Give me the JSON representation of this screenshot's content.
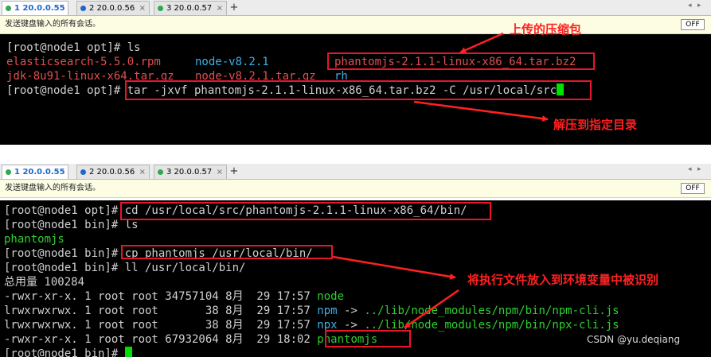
{
  "window1": {
    "tabs": [
      {
        "label": "1 20.0.0.55",
        "active": true,
        "dot_color": "#2fa84f"
      },
      {
        "label": "2 20.0.0.56",
        "active": false,
        "dot_color": "#1f66c9"
      },
      {
        "label": "3 20.0.0.57",
        "active": false,
        "dot_color": "#2fa84f"
      }
    ],
    "add_tab": "+",
    "send_bar_text": "发送键盘输入的所有会话。",
    "off_button": "OFF",
    "terminal": {
      "prompt1": "[root@node1 opt]# ",
      "cmd1": "ls",
      "file_es": "elasticsearch-5.5.0.rpm",
      "file_node": "node-v8.2.1",
      "file_phantom": "phantomjs-2.1.1-linux-x86_64.tar.bz2",
      "file_jdk": "jdk-8u91-linux-x64.tar.gz",
      "file_nodetar": "node-v8.2.1.tar.gz",
      "file_rh": "rh",
      "prompt2": "[root@node1 opt]# ",
      "cmd2": "tar -jxvf phantomjs-2.1.1-linux-x86_64.tar.bz2 -C /usr/local/src"
    }
  },
  "window2": {
    "tabs": [
      {
        "label": "1 20.0.0.55",
        "active": true,
        "dot_color": "#2fa84f"
      },
      {
        "label": "2 20.0.0.56",
        "active": false,
        "dot_color": "#1f66c9"
      },
      {
        "label": "3 20.0.0.57",
        "active": false,
        "dot_color": "#2fa84f"
      }
    ],
    "add_tab": "+",
    "send_bar_text": "发送键盘输入的所有会话。",
    "off_button": "OFF",
    "terminal": {
      "l1_prompt": "[root@node1 opt]# ",
      "l1_cmd": "cd /usr/local/src/phantomjs-2.1.1-linux-x86_64/bin/",
      "l2_prompt": "[root@node1 bin]# ",
      "l2_cmd": "ls",
      "l3": "phantomjs",
      "l4_prompt": "[root@node1 bin]# ",
      "l4_cmd": "cp phantomjs /usr/local/bin/",
      "l5_prompt": "[root@node1 bin]# ",
      "l5_cmd": "ll /usr/local/bin/",
      "l6": "总用量 100284",
      "r1_meta": "-rwxr-xr-x. 1 root root 34757104 8月  29 17:57 ",
      "r1_name": "node",
      "r2_meta": "lrwxrwxrwx. 1 root root       38 8月  29 17:57 ",
      "r2_name": "npm",
      "r2_arrow": " -> ",
      "r2_target": "../lib/node_modules/npm/bin/npm-cli.js",
      "r3_meta": "lrwxrwxrwx. 1 root root       38 8月  29 17:57 ",
      "r3_name": "npx",
      "r3_arrow": " -> ",
      "r3_target": "../lib/node_modules/npm/bin/npx-cli.js",
      "r4_meta": "-rwxr-xr-x. 1 root root 67932064 8月  29 18:02 ",
      "r4_name": "phantomjs",
      "l11_prompt": "[root@node1 bin]# "
    }
  },
  "annotations": {
    "uploaded_package": "上传的压缩包",
    "extract_to_dir": "解压到指定目录",
    "put_exec_into_path": "将执行文件放入到环境变量中被识别"
  },
  "watermark": "CSDN @yu.deqiang",
  "colors": {
    "red_text": "#e05050",
    "cyan_text": "#3db0e8",
    "green_text": "#2ed12e",
    "annotation_red": "#ff2020",
    "box_red": "#e8162a"
  }
}
